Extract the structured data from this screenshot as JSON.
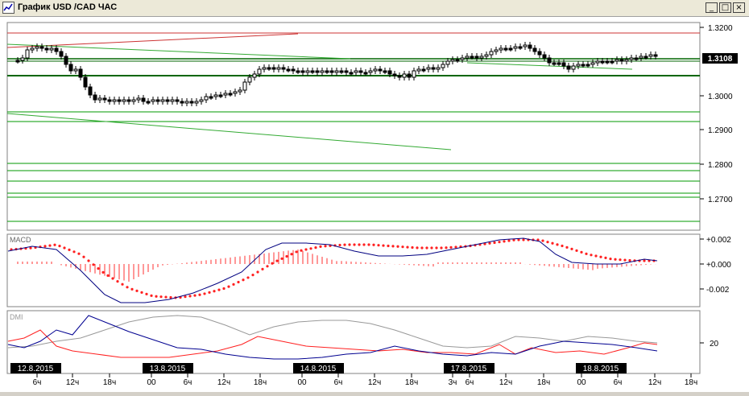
{
  "window": {
    "title": "График USD /CAD  ЧАС",
    "minimize_label": "_",
    "maximize_label": "□",
    "close_label": "×"
  },
  "price_axis": {
    "labels": [
      "1.3200",
      "1.3100",
      "1.3000",
      "1.2900",
      "1.2800",
      "1.2700"
    ],
    "current_price": "1.3108"
  },
  "macd": {
    "label": "MACD",
    "axis_labels": [
      "+0.002",
      "+0.000",
      "-0.002"
    ]
  },
  "dmi": {
    "label": "DMI",
    "axis_labels": [
      "20"
    ]
  },
  "time_axis": {
    "date_labels": [
      "12.8.2015",
      "13.8.2015",
      "14.8.2015",
      "17.8.2015",
      "18.8.2015"
    ],
    "hour_labels": [
      "6ч",
      "12ч",
      "18ч",
      "00",
      "6ч",
      "12ч",
      "18ч",
      "00",
      "6ч",
      "12ч",
      "18ч",
      "3ч",
      "6ч",
      "12ч",
      "18ч",
      "00",
      "6ч",
      "12ч",
      "18ч"
    ]
  },
  "colors": {
    "window_bg": "#d4d0c8",
    "chart_bg": "#ffffff",
    "grid": "#009900",
    "support_line": "#006600",
    "resistance_line": "#cc3333",
    "trend_line": "#33aa33",
    "candles": "#000000",
    "macd_line": "#000080",
    "macd_signal": "#ff2020",
    "macd_histogram": "#ff3030",
    "dmi_plus": "#ff2020",
    "dmi_minus": "#000090",
    "adx": "#999999",
    "price_label_bg": "#000000"
  }
}
